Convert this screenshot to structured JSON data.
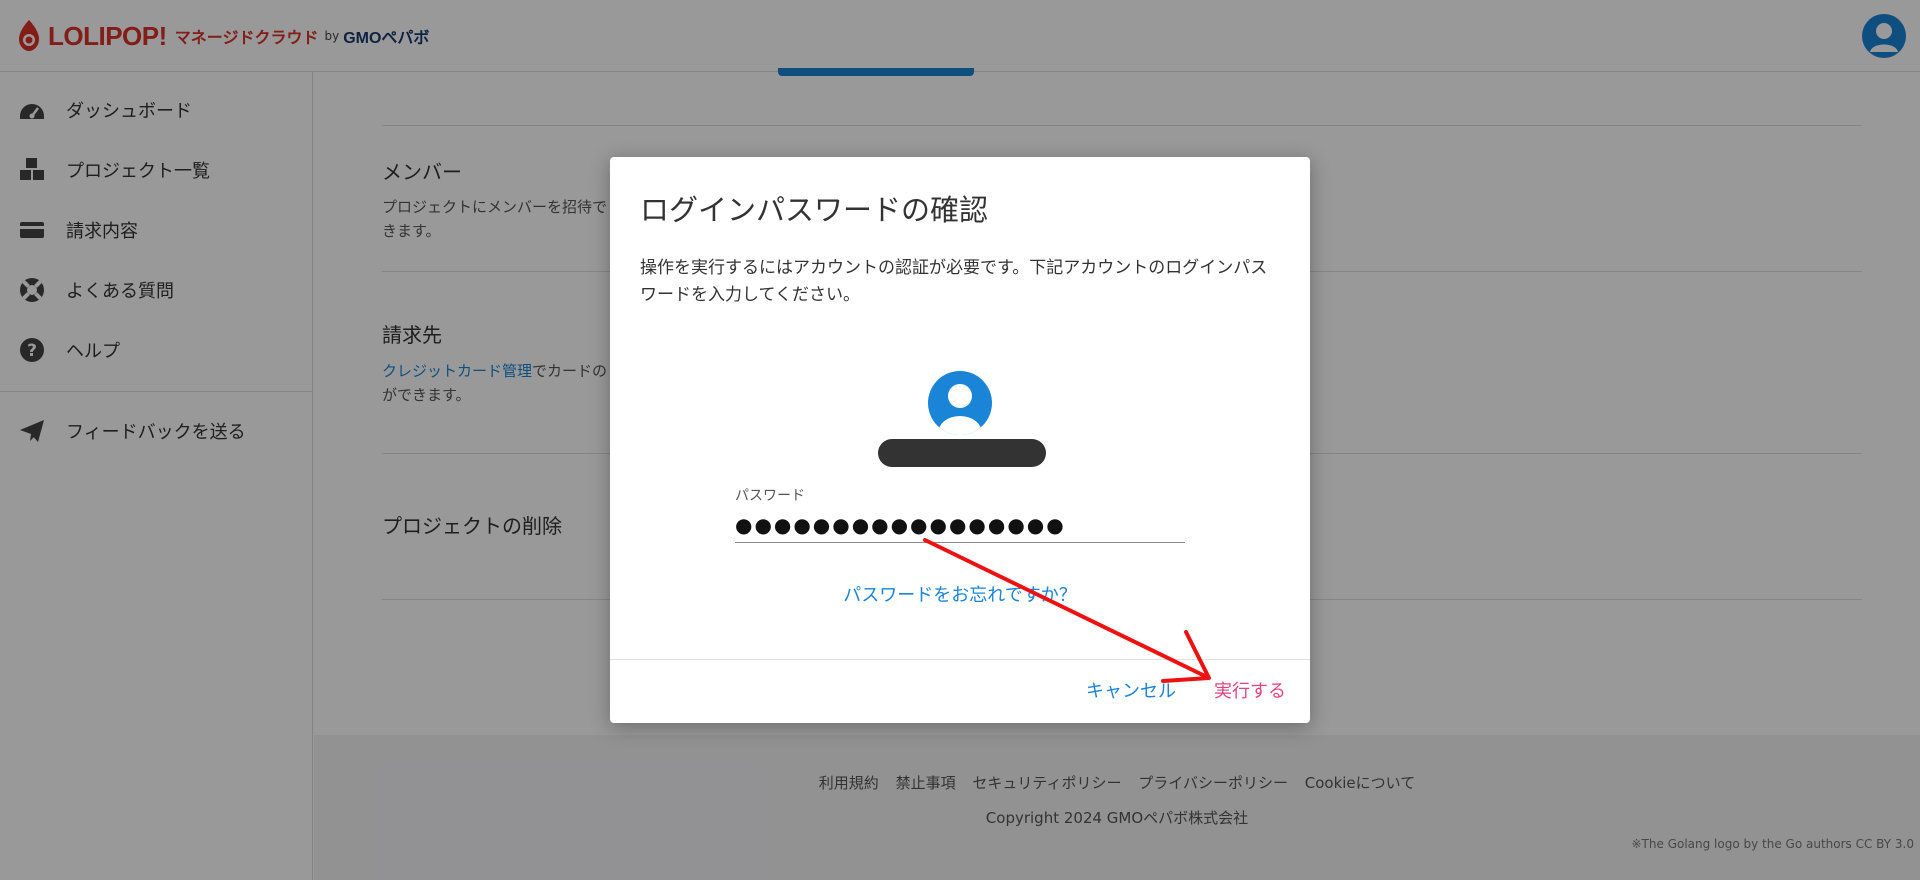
{
  "header": {
    "logo_text": "LOLIPOP!",
    "logo_sub": "マネージドクラウド",
    "logo_by": "by",
    "logo_gmo": "GMOペパボ"
  },
  "sidebar": {
    "items": [
      {
        "label": "ダッシュボード",
        "icon": "dashboard-icon"
      },
      {
        "label": "プロジェクト一覧",
        "icon": "cubes-icon"
      },
      {
        "label": "請求内容",
        "icon": "credit-card-icon"
      },
      {
        "label": "よくある質問",
        "icon": "lifebuoy-icon"
      },
      {
        "label": "ヘルプ",
        "icon": "question-circle-icon"
      },
      {
        "label": "フィードバックを送る",
        "icon": "paper-plane-icon"
      }
    ]
  },
  "main": {
    "sections": [
      {
        "title": "メンバー",
        "desc_line1": "プロジェクトにメンバーを招待で",
        "desc_line2": "きます。"
      },
      {
        "title": "請求先",
        "link": "クレジットカード管理",
        "desc_line1": "でカードの",
        "desc_line2": "ができます。"
      },
      {
        "title": "プロジェクトの削除"
      }
    ]
  },
  "footer": {
    "links": [
      "利用規約",
      "禁止事項",
      "セキュリティポリシー",
      "プライバシーポリシー",
      "Cookieについて"
    ],
    "copyright": "Copyright 2024 GMOペパボ株式会社",
    "note": "※The Golang logo by the Go authors CC BY 3.0"
  },
  "modal": {
    "title": "ログインパスワードの確認",
    "body": "操作を実行するにはアカウントの認証が必要です。下記アカウントのログインパスワードを入力してください。",
    "password_label": "パスワード",
    "password_value": "●●●●●●●●●●●●●●●●●",
    "forgot_link": "パスワードをお忘れですか？",
    "cancel_label": "キャンセル",
    "run_label": "実行する"
  },
  "colors": {
    "brand_red": "#d9312b",
    "link_blue": "#1a84d6",
    "action_pink": "#e0457b",
    "annotation_red": "#ee1111"
  }
}
